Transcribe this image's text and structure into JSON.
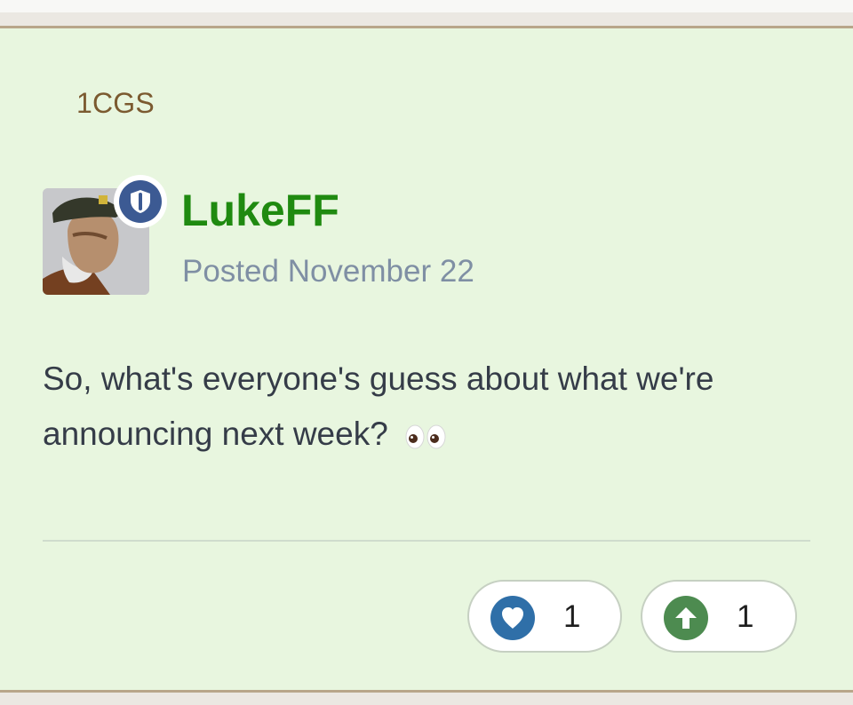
{
  "post": {
    "group": "1CGS",
    "author": {
      "name": "LukeFF",
      "badge_icon": "shield-icon",
      "avatar": "avatar-soldier-icon"
    },
    "date": "Posted November 22",
    "body": "So, what's everyone's guess about what we're announcing next week?",
    "emoji": "eyes-emoji"
  },
  "reactions": [
    {
      "icon": "heart-icon",
      "count": "1",
      "color": "#2f6fa8"
    },
    {
      "icon": "upvote-arrow-icon",
      "count": "1",
      "color": "#4d8b50"
    }
  ],
  "colors": {
    "background": "#e8f6df",
    "author": "#1f8a10",
    "group": "#7b5a30",
    "date": "#7f8fa4"
  }
}
